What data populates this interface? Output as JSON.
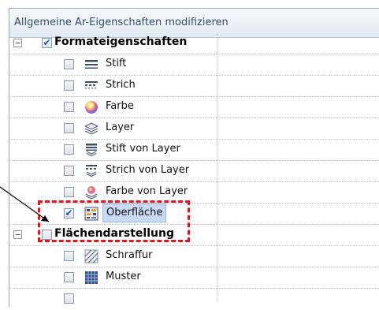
{
  "window": {
    "title": "Allgemeine Ar-Eigenschaften modifizieren"
  },
  "tree": {
    "groups": [
      {
        "expander": "−",
        "checked": true,
        "label": "Formateigenschaften",
        "items": [
          {
            "label": "Stift",
            "checked": false,
            "icon": "pen-lines-icon"
          },
          {
            "label": "Strich",
            "checked": false,
            "icon": "dashed-line-icon"
          },
          {
            "label": "Farbe",
            "checked": false,
            "icon": "color-wheel-icon"
          },
          {
            "label": "Layer",
            "checked": false,
            "icon": "layer-stack-icon"
          },
          {
            "label": "Stift von Layer",
            "checked": false,
            "icon": "pen-from-layer-icon"
          },
          {
            "label": "Strich von Layer",
            "checked": false,
            "icon": "line-from-layer-icon"
          },
          {
            "label": "Farbe von Layer",
            "checked": false,
            "icon": "color-from-layer-icon"
          },
          {
            "label": "Oberfläche",
            "checked": true,
            "selected": true,
            "icon": "surface-texture-icon"
          }
        ]
      },
      {
        "expander": "−",
        "checked": false,
        "label": "Flächendarstellung",
        "items": [
          {
            "label": "Schraffur",
            "checked": false,
            "icon": "hatching-icon"
          },
          {
            "label": "Muster",
            "checked": false,
            "icon": "pattern-grid-icon"
          }
        ]
      }
    ]
  },
  "colors": {
    "highlight_dash": "#e8141b",
    "selection": "#c9daf6",
    "check": "#1d56b8"
  }
}
